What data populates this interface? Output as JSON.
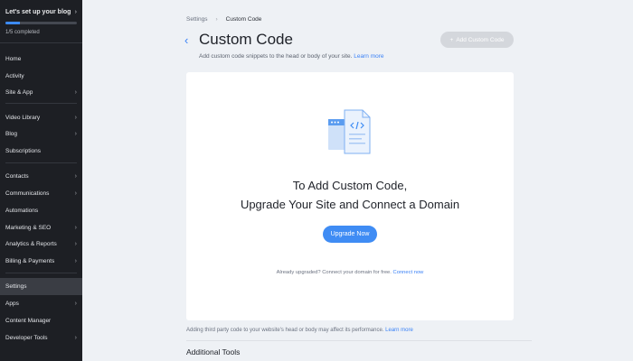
{
  "sidebar": {
    "setup_title": "Let's set up your blog",
    "progress_fraction": 0.2,
    "progress_text": "1/5 completed",
    "items": [
      {
        "label": "Home"
      },
      {
        "label": "Activity"
      },
      {
        "label": "Site & App"
      },
      {
        "label": "Video Library"
      },
      {
        "label": "Blog"
      },
      {
        "label": "Subscriptions"
      },
      {
        "label": "Contacts"
      },
      {
        "label": "Communications"
      },
      {
        "label": "Automations"
      },
      {
        "label": "Marketing & SEO"
      },
      {
        "label": "Analytics & Reports"
      },
      {
        "label": "Billing & Payments"
      },
      {
        "label": "Settings"
      },
      {
        "label": "Apps"
      },
      {
        "label": "Content Manager"
      },
      {
        "label": "Developer Tools"
      }
    ]
  },
  "breadcrumb": {
    "parent": "Settings",
    "current": "Custom Code"
  },
  "header": {
    "title": "Custom Code",
    "subtitle": "Add custom code snippets to the head or body of your site.",
    "learn_more": "Learn more",
    "add_button": "Add Custom Code"
  },
  "card": {
    "heading_line1": "To Add Custom Code,",
    "heading_line2": "Upgrade Your Site and Connect a Domain",
    "upgrade_button": "Upgrade Now",
    "already_text": "Already upgraded? Connect your domain for free.",
    "connect_link": "Connect now"
  },
  "footnote": {
    "text": "Adding third party code to your website's head or body may affect its performance.",
    "link": "Learn more"
  },
  "additional_tools": "Additional Tools",
  "colors": {
    "accent": "#3f8cf4",
    "sidebar_bg": "#1d1f24",
    "page_bg": "#eef1f5"
  }
}
